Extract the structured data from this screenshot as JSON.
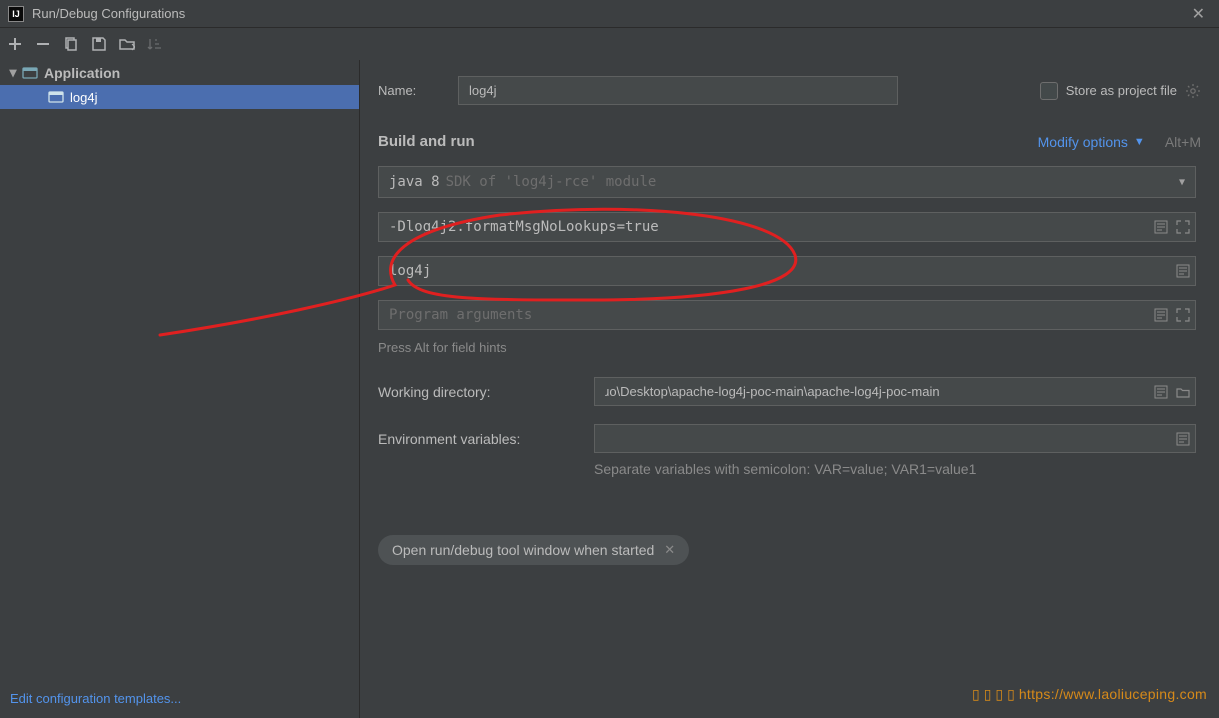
{
  "window": {
    "title": "Run/Debug Configurations"
  },
  "tree": {
    "root": "Application",
    "item": "log4j"
  },
  "sidebar": {
    "edit_templates": "Edit configuration templates..."
  },
  "form": {
    "name_label": "Name:",
    "name_value": "log4j",
    "store_label": "Store as project file",
    "section_build": "Build and run",
    "modify_options": "Modify options",
    "modify_shortcut": "Alt+M",
    "jdk_prefix": "java 8",
    "jdk_rest": "SDK of 'log4j-rce' module",
    "vm_options": "-Dlog4j2.formatMsgNoLookups=true",
    "main_class": "log4j",
    "program_args_placeholder": "Program arguments",
    "hint": "Press Alt for field hints",
    "working_dir_label": "Working directory:",
    "working_dir_value": "ɹo\\Desktop\\apache-log4j-poc-main\\apache-log4j-poc-main",
    "env_label": "Environment variables:",
    "env_value": "",
    "env_hint": "Separate variables with semicolon: VAR=value; VAR1=value1",
    "chip": "Open run/debug tool window when started"
  },
  "watermark": "https://www.laoliuceping.com"
}
